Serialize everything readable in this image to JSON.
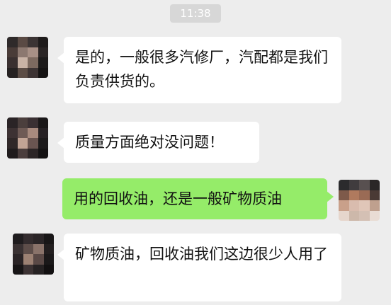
{
  "chat": {
    "timestamp": "11:38",
    "messages": [
      {
        "side": "in",
        "text": "是的，一般很多汽修厂，汽配都是我们负责供货的。"
      },
      {
        "side": "in",
        "text": "质量方面绝对没问题！"
      },
      {
        "side": "out",
        "text": "用的回收油，还是一般矿物质油"
      },
      {
        "side": "in",
        "text": "矿物质油，回收油我们这边很少人用了"
      }
    ]
  },
  "colors": {
    "background": "#ededed",
    "incoming_bubble": "#ffffff",
    "outgoing_bubble": "#95ec69",
    "timestamp_bg": "#d7d7d7"
  }
}
